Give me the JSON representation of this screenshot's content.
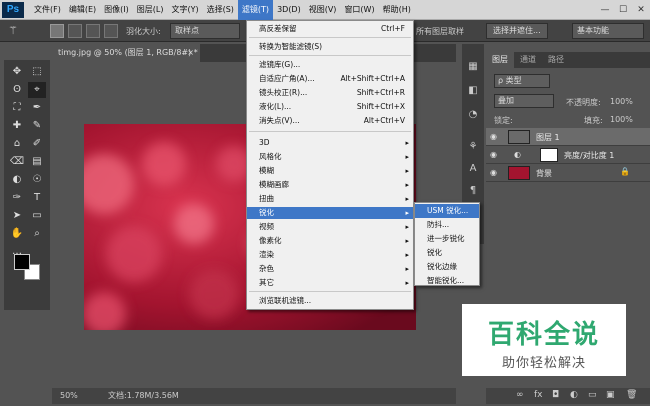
{
  "app": {
    "logo": "Ps"
  },
  "menubar": {
    "items": [
      "文件(F)",
      "编辑(E)",
      "图像(I)",
      "图层(L)",
      "文字(Y)",
      "选择(S)",
      "滤镜(T)",
      "3D(D)",
      "视图(V)",
      "窗口(W)",
      "帮助(H)"
    ],
    "active_index": 6,
    "window_controls": [
      "—",
      "☐",
      "✕"
    ]
  },
  "options": {
    "feather_label": "羽化大小:",
    "sample_select": "取样点",
    "all_layers_label": "所有图层取样",
    "select_subject_button": "选择并遮住...",
    "workspace_select": "基本功能"
  },
  "document": {
    "tab_title": "timg.jpg @ 50% (图层 1, RGB/8#) *",
    "tab_close": "×",
    "zoom": "50%",
    "doc_size": "文档:1.78M/3.56M"
  },
  "tools": [
    "✥",
    "⬚",
    "ʘ",
    "⌖",
    "⛶",
    "✒",
    "✚",
    "✎",
    "⌂",
    "✐",
    "⌫",
    "▤",
    "◐",
    "☉",
    "✑",
    "T",
    "➤",
    "▭",
    "✋",
    "⌕",
    "…"
  ],
  "filter_menu": {
    "items": [
      {
        "label": "高反差保留",
        "shortcut": "Ctrl+F"
      },
      {
        "label": "转换为智能滤镜(S)",
        "shortcut": ""
      },
      {
        "label": "滤镜库(G)...",
        "shortcut": ""
      },
      {
        "label": "自适应广角(A)...",
        "shortcut": "Alt+Shift+Ctrl+A"
      },
      {
        "label": "镜头校正(R)...",
        "shortcut": "Shift+Ctrl+R"
      },
      {
        "label": "液化(L)...",
        "shortcut": "Shift+Ctrl+X"
      },
      {
        "label": "消失点(V)...",
        "shortcut": "Alt+Ctrl+V"
      },
      {
        "label": "3D",
        "shortcut": ""
      },
      {
        "label": "风格化",
        "shortcut": ""
      },
      {
        "label": "模糊",
        "shortcut": ""
      },
      {
        "label": "模糊画廊",
        "shortcut": ""
      },
      {
        "label": "扭曲",
        "shortcut": ""
      },
      {
        "label": "锐化",
        "shortcut": ""
      },
      {
        "label": "视频",
        "shortcut": ""
      },
      {
        "label": "像素化",
        "shortcut": ""
      },
      {
        "label": "渲染",
        "shortcut": ""
      },
      {
        "label": "杂色",
        "shortcut": ""
      },
      {
        "label": "其它",
        "shortcut": ""
      },
      {
        "label": "浏览联机滤镜...",
        "shortcut": ""
      }
    ],
    "submenu_arrow": "▸"
  },
  "sharpen_submenu": {
    "items": [
      "USM 锐化...",
      "防抖...",
      "进一步锐化",
      "锐化",
      "锐化边缘",
      "智能锐化..."
    ]
  },
  "layers_panel": {
    "tabs": [
      "图层",
      "通道",
      "路径"
    ],
    "kind_label": "ρ 类型",
    "blend_mode": "叠加",
    "opacity_label": "不透明度:",
    "opacity_value": "100%",
    "lock_label": "锁定:",
    "fill_label": "填充:",
    "fill_value": "100%",
    "layers": [
      {
        "name": "图层 1"
      },
      {
        "name": "亮度/对比度 1"
      },
      {
        "name": "背景"
      }
    ],
    "bottom_icons": [
      "∞",
      "fx",
      "◘",
      "◐",
      "▭",
      "▣",
      "🗑"
    ]
  },
  "watermark": {
    "title": "百科全说",
    "subtitle": "助你轻松解决"
  },
  "colors": {
    "menu_highlight": "#3e77c7",
    "canvas_red": "#9a0f2c",
    "watermark_green": "#2fa870"
  }
}
